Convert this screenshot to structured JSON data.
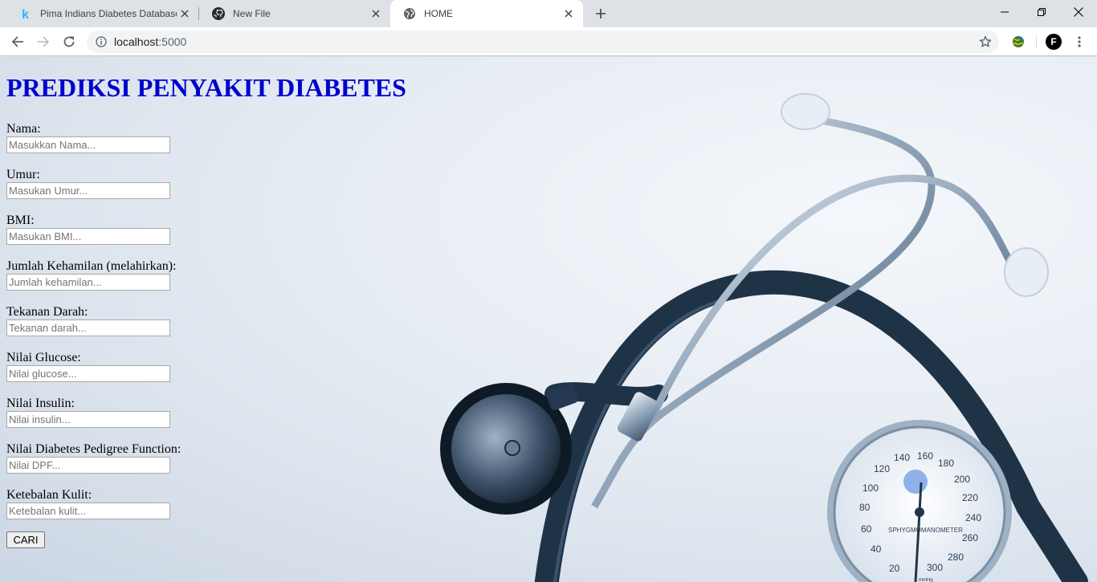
{
  "browser": {
    "tabs": [
      {
        "title": "Pima Indians Diabetes Database |",
        "icon": "kaggle-k-icon",
        "active": false
      },
      {
        "title": "New File",
        "icon": "github-icon",
        "active": false
      },
      {
        "title": "HOME",
        "icon": "globe-icon",
        "active": true
      }
    ],
    "url_host": "localhost",
    "url_port": ":5000",
    "profile_initial": "F"
  },
  "page": {
    "heading": "PREDIKSI PENYAKIT DIABETES",
    "fields": [
      {
        "label": "Nama:",
        "placeholder": "Masukkan Nama...",
        "value": ""
      },
      {
        "label": "Umur:",
        "placeholder": "Masukan Umur...",
        "value": ""
      },
      {
        "label": "BMI:",
        "placeholder": "Masukan BMI...",
        "value": ""
      },
      {
        "label": "Jumlah Kehamilan (melahirkan):",
        "placeholder": "Jumlah kehamilan...",
        "value": ""
      },
      {
        "label": "Tekanan Darah:",
        "placeholder": "Tekanan darah...",
        "value": ""
      },
      {
        "label": "Nilai Glucose:",
        "placeholder": "Nilai glucose...",
        "value": ""
      },
      {
        "label": "Nilai Insulin:",
        "placeholder": "Nilai insulin...",
        "value": ""
      },
      {
        "label": "Nilai Diabetes Pedigree Function:",
        "placeholder": "Nilai DPF...",
        "value": ""
      },
      {
        "label": "Ketebalan Kulit:",
        "placeholder": "Ketebalan kulit...",
        "value": ""
      }
    ],
    "submit_label": "CARI"
  },
  "background_image": {
    "gauge_label": "SPHYGMOMANOMETER",
    "gauge_unit": "mmHg",
    "gauge_ticks": [
      "20",
      "40",
      "60",
      "80",
      "100",
      "120",
      "140",
      "160",
      "180",
      "200",
      "220",
      "240",
      "260",
      "280",
      "300"
    ]
  },
  "colors": {
    "heading": "#0000cd",
    "tabstrip": "#dee1e6",
    "tubing": "#1f3347"
  }
}
